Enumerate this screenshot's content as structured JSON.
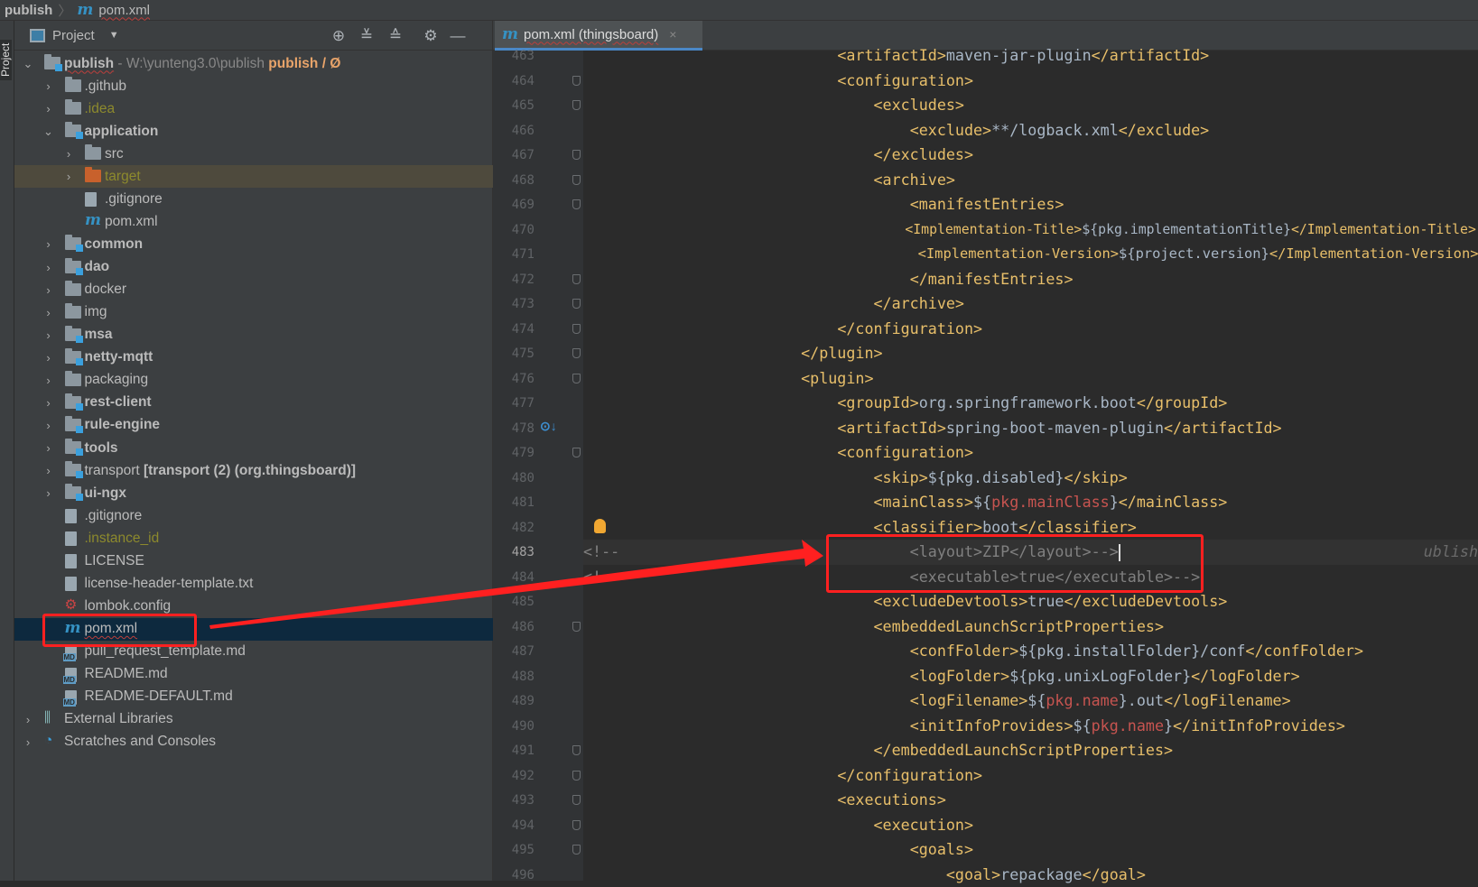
{
  "breadcrumb": {
    "root": "publish",
    "file": "pom.xml"
  },
  "sidebar_strip": {
    "label": "Project"
  },
  "project_panel": {
    "title": "Project",
    "toolbar_icons": [
      "locate-icon",
      "expand-all-icon",
      "collapse-all-icon",
      "gear-icon",
      "minimize-icon"
    ],
    "tree": [
      {
        "label": "publish",
        "level": 0,
        "icon": "module-folder",
        "bold": true,
        "chevron": "down",
        "extra": " - W:\\yunteng3.0\\publish",
        "extra2": " publish / Ø"
      },
      {
        "label": ".github",
        "level": 1,
        "icon": "folder",
        "chevron": "right"
      },
      {
        "label": ".idea",
        "level": 1,
        "icon": "folder",
        "chevron": "right",
        "color": "#8d8a2d"
      },
      {
        "label": "application",
        "level": 1,
        "icon": "module-folder",
        "bold": true,
        "chevron": "down"
      },
      {
        "label": "src",
        "level": 2,
        "icon": "folder",
        "chevron": "right"
      },
      {
        "label": "target",
        "level": 2,
        "icon": "excluded-folder",
        "chevron": "right",
        "color": "#8d8a2d",
        "highlight": true
      },
      {
        "label": ".gitignore",
        "level": 2,
        "icon": "ignore-file"
      },
      {
        "label": "pom.xml",
        "level": 2,
        "icon": "maven"
      },
      {
        "label": "common",
        "level": 1,
        "icon": "module-folder",
        "bold": true,
        "chevron": "right"
      },
      {
        "label": "dao",
        "level": 1,
        "icon": "module-folder",
        "bold": true,
        "chevron": "right"
      },
      {
        "label": "docker",
        "level": 1,
        "icon": "folder",
        "chevron": "right"
      },
      {
        "label": "img",
        "level": 1,
        "icon": "folder",
        "chevron": "right"
      },
      {
        "label": "msa",
        "level": 1,
        "icon": "module-folder",
        "bold": true,
        "chevron": "right"
      },
      {
        "label": "netty-mqtt",
        "level": 1,
        "icon": "module-folder",
        "bold": true,
        "chevron": "right"
      },
      {
        "label": "packaging",
        "level": 1,
        "icon": "folder",
        "chevron": "right"
      },
      {
        "label": "rest-client",
        "level": 1,
        "icon": "module-folder",
        "bold": true,
        "chevron": "right"
      },
      {
        "label": "rule-engine",
        "level": 1,
        "icon": "module-folder",
        "bold": true,
        "chevron": "right"
      },
      {
        "label": "tools",
        "level": 1,
        "icon": "module-folder",
        "bold": true,
        "chevron": "right"
      },
      {
        "label": "transport",
        "level": 1,
        "icon": "module-folder",
        "chevron": "right",
        "extra": " [transport (2) (org.thingsboard)]"
      },
      {
        "label": "ui-ngx",
        "level": 1,
        "icon": "module-folder",
        "bold": true,
        "chevron": "right"
      },
      {
        "label": ".gitignore",
        "level": 1,
        "icon": "ignore-file"
      },
      {
        "label": ".instance_id",
        "level": 1,
        "icon": "file",
        "color": "#8d8a2d"
      },
      {
        "label": "LICENSE",
        "level": 1,
        "icon": "file"
      },
      {
        "label": "license-header-template.txt",
        "level": 1,
        "icon": "file"
      },
      {
        "label": "lombok.config",
        "level": 1,
        "icon": "config"
      },
      {
        "label": "pom.xml",
        "level": 1,
        "icon": "maven",
        "selected": true
      },
      {
        "label": "pull_request_template.md",
        "level": 1,
        "icon": "md"
      },
      {
        "label": "README.md",
        "level": 1,
        "icon": "md"
      },
      {
        "label": "README-DEFAULT.md",
        "level": 1,
        "icon": "md"
      },
      {
        "label": "External Libraries",
        "level": 0,
        "icon": "libraries",
        "chevron": "right"
      },
      {
        "label": "Scratches and Consoles",
        "level": 0,
        "icon": "scratches",
        "chevron": "right"
      }
    ]
  },
  "editor": {
    "tab": {
      "label": "pom.xml (thingsboard)",
      "close": "×"
    },
    "current_line": 483,
    "right_hint": "ublish",
    "fold_marker_lines": [
      464,
      465,
      467,
      468,
      469,
      472,
      473,
      474,
      475,
      476,
      479,
      486,
      491,
      492,
      493,
      494,
      495
    ],
    "lines": [
      {
        "n": 463,
        "i": 28,
        "tk": [
          [
            "t",
            "<artifactId>"
          ],
          [
            "x",
            "maven-jar-plugin"
          ],
          [
            "t",
            "</artifactId>"
          ]
        ]
      },
      {
        "n": 464,
        "i": 28,
        "tk": [
          [
            "t",
            "<configuration>"
          ]
        ]
      },
      {
        "n": 465,
        "i": 32,
        "tk": [
          [
            "t",
            "<excludes>"
          ]
        ]
      },
      {
        "n": 466,
        "i": 36,
        "tk": [
          [
            "t",
            "<exclude>"
          ],
          [
            "x",
            "**/logback.xml"
          ],
          [
            "t",
            "</exclude>"
          ]
        ]
      },
      {
        "n": 467,
        "i": 32,
        "tk": [
          [
            "t",
            "</excludes>"
          ]
        ]
      },
      {
        "n": 468,
        "i": 32,
        "tk": [
          [
            "t",
            "<archive>"
          ]
        ]
      },
      {
        "n": 469,
        "i": 36,
        "tk": [
          [
            "t",
            "<manifestEntries>"
          ]
        ]
      },
      {
        "n": 470,
        "i": 40,
        "tk": [
          [
            "t",
            "<Implementation-Title>"
          ],
          [
            "x",
            "${pkg.implementationTitle}"
          ],
          [
            "t",
            "</Implementation-Title>"
          ]
        ]
      },
      {
        "n": 471,
        "i": 40,
        "tk": [
          [
            "t",
            "<Implementation-Version>"
          ],
          [
            "x",
            "${project.version}"
          ],
          [
            "t",
            "</Implementation-Version>"
          ]
        ]
      },
      {
        "n": 472,
        "i": 36,
        "tk": [
          [
            "t",
            "</manifestEntries>"
          ]
        ]
      },
      {
        "n": 473,
        "i": 32,
        "tk": [
          [
            "t",
            "</archive>"
          ]
        ]
      },
      {
        "n": 474,
        "i": 28,
        "tk": [
          [
            "t",
            "</configuration>"
          ]
        ]
      },
      {
        "n": 475,
        "i": 24,
        "tk": [
          [
            "t",
            "</plugin>"
          ]
        ]
      },
      {
        "n": 476,
        "i": 24,
        "tk": [
          [
            "t",
            "<plugin>"
          ]
        ]
      },
      {
        "n": 477,
        "i": 28,
        "tk": [
          [
            "t",
            "<groupId>"
          ],
          [
            "x",
            "org.springframework.boot"
          ],
          [
            "t",
            "</groupId>"
          ]
        ]
      },
      {
        "n": 478,
        "i": 28,
        "tk": [
          [
            "t",
            "<artifactId>"
          ],
          [
            "x",
            "spring-boot-maven-plugin"
          ],
          [
            "t",
            "</artifactId>"
          ]
        ]
      },
      {
        "n": 479,
        "i": 28,
        "tk": [
          [
            "t",
            "<configuration>"
          ]
        ]
      },
      {
        "n": 480,
        "i": 32,
        "tk": [
          [
            "t",
            "<skip>"
          ],
          [
            "x",
            "${pkg.disabled}"
          ],
          [
            "t",
            "</skip>"
          ]
        ]
      },
      {
        "n": 481,
        "i": 32,
        "tk": [
          [
            "t",
            "<mainClass>"
          ],
          [
            "x",
            "${"
          ],
          [
            "v",
            "pkg.mainClass"
          ],
          [
            "x",
            "}"
          ],
          [
            "t",
            "</mainClass>"
          ]
        ]
      },
      {
        "n": 482,
        "i": 32,
        "tk": [
          [
            "t",
            "<classifier>"
          ],
          [
            "x",
            "boot"
          ],
          [
            "t",
            "</classifier>"
          ]
        ]
      },
      {
        "n": 483,
        "i": 0,
        "tk": [
          [
            "c",
            "<!--                                <layout>ZIP</layout>-->"
          ]
        ]
      },
      {
        "n": 484,
        "i": 0,
        "tk": [
          [
            "c",
            "<!--                                <executable>true</executable>-->"
          ]
        ]
      },
      {
        "n": 485,
        "i": 32,
        "tk": [
          [
            "t",
            "<excludeDevtools>"
          ],
          [
            "x",
            "true"
          ],
          [
            "t",
            "</excludeDevtools>"
          ]
        ]
      },
      {
        "n": 486,
        "i": 32,
        "tk": [
          [
            "t",
            "<embeddedLaunchScriptProperties>"
          ]
        ]
      },
      {
        "n": 487,
        "i": 36,
        "tk": [
          [
            "t",
            "<confFolder>"
          ],
          [
            "x",
            "${pkg.installFolder}/conf"
          ],
          [
            "t",
            "</confFolder>"
          ]
        ]
      },
      {
        "n": 488,
        "i": 36,
        "tk": [
          [
            "t",
            "<logFolder>"
          ],
          [
            "x",
            "${pkg.unixLogFolder}"
          ],
          [
            "t",
            "</logFolder>"
          ]
        ]
      },
      {
        "n": 489,
        "i": 36,
        "tk": [
          [
            "t",
            "<logFilename>"
          ],
          [
            "x",
            "${"
          ],
          [
            "v",
            "pkg.name"
          ],
          [
            "x",
            "}.out"
          ],
          [
            "t",
            "</logFilename>"
          ]
        ]
      },
      {
        "n": 490,
        "i": 36,
        "tk": [
          [
            "t",
            "<initInfoProvides>"
          ],
          [
            "x",
            "${"
          ],
          [
            "v",
            "pkg.name"
          ],
          [
            "x",
            "}"
          ],
          [
            "t",
            "</initInfoProvides>"
          ]
        ]
      },
      {
        "n": 491,
        "i": 32,
        "tk": [
          [
            "t",
            "</embeddedLaunchScriptProperties>"
          ]
        ]
      },
      {
        "n": 492,
        "i": 28,
        "tk": [
          [
            "t",
            "</configuration>"
          ]
        ]
      },
      {
        "n": 493,
        "i": 28,
        "tk": [
          [
            "t",
            "<executions>"
          ]
        ]
      },
      {
        "n": 494,
        "i": 32,
        "tk": [
          [
            "t",
            "<execution>"
          ]
        ]
      },
      {
        "n": 495,
        "i": 36,
        "tk": [
          [
            "t",
            "<goals>"
          ]
        ]
      },
      {
        "n": 496,
        "i": 40,
        "tk": [
          [
            "t",
            "<goal>"
          ],
          [
            "x",
            "repackage"
          ],
          [
            "t",
            "</goal>"
          ]
        ]
      }
    ]
  },
  "annotation_color": "#ff2020"
}
